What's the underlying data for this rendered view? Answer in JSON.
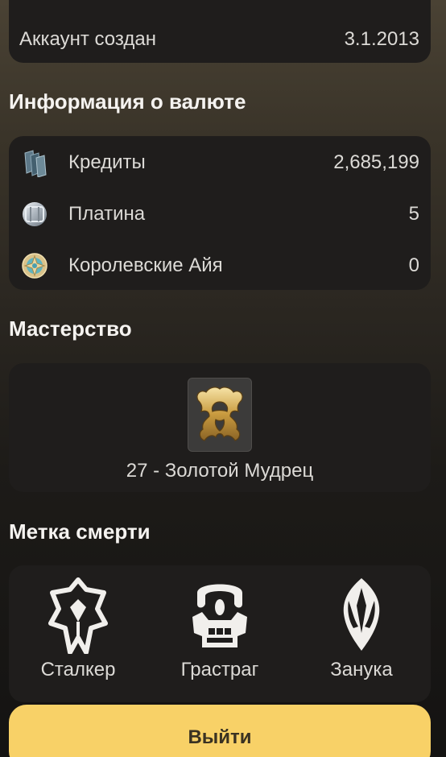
{
  "account": {
    "created_label": "Аккаунт создан",
    "created_value": "3.1.2013"
  },
  "currency": {
    "title": "Информация о валюте",
    "items": [
      {
        "icon": "credits-icon",
        "label": "Кредиты",
        "value": "2,685,199"
      },
      {
        "icon": "platinum-icon",
        "label": "Платина",
        "value": "5"
      },
      {
        "icon": "aya-icon",
        "label": "Королевские Айя",
        "value": "0"
      }
    ]
  },
  "mastery": {
    "title": "Мастерство",
    "icon": "mastery-rank-icon",
    "rank_text": "27 - Золотой Мудрец"
  },
  "death_marks": {
    "title": "Метка смерти",
    "items": [
      {
        "icon": "stalker-icon",
        "label": "Сталкер"
      },
      {
        "icon": "grustrag-icon",
        "label": "Грастраг"
      },
      {
        "icon": "zanuka-icon",
        "label": "Занука"
      }
    ]
  },
  "logout_label": "Выйти"
}
